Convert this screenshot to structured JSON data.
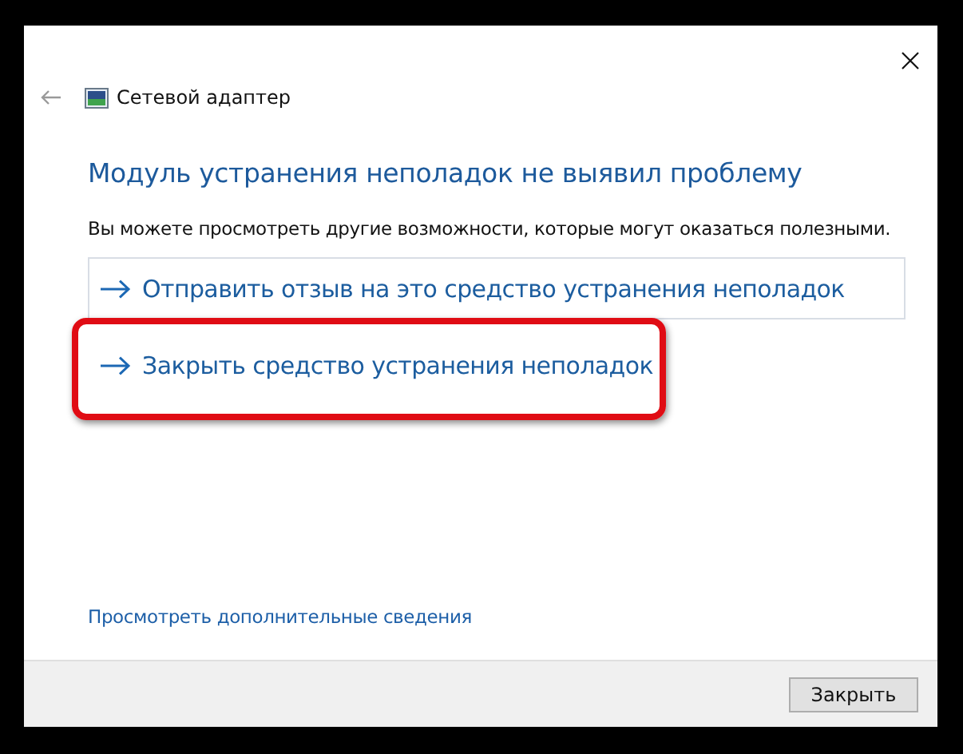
{
  "window": {
    "title": "Сетевой адаптер"
  },
  "heading": "Модуль устранения неполадок не выявил проблему",
  "description": "Вы можете просмотреть другие возможности, которые могут оказаться полезными.",
  "options": [
    {
      "label": "Отправить отзыв на это средство устранения неполадок",
      "selected": true,
      "annotated": false
    },
    {
      "label": "Закрыть средство устранения неполадок",
      "selected": false,
      "annotated": true
    }
  ],
  "details_link": "Просмотреть дополнительные сведения",
  "buttons": [
    "Закрыть"
  ]
}
